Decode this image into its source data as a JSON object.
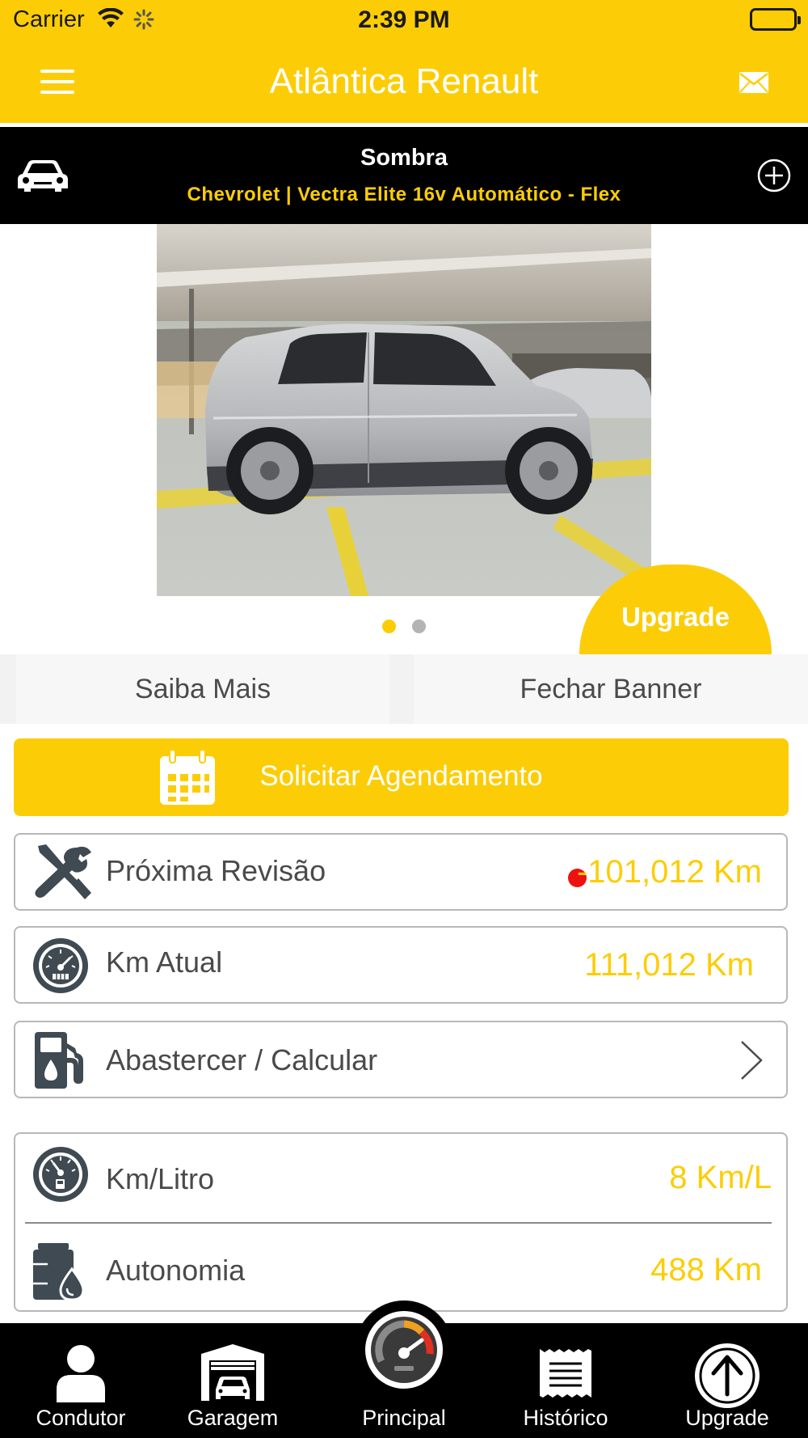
{
  "status_bar": {
    "carrier": "Carrier",
    "time": "2:39 PM"
  },
  "navbar": {
    "title": "Atlântica Renault",
    "menu_icon": "hamburger-menu-icon",
    "mail_icon": "envelope-icon"
  },
  "vehicle": {
    "name": "Sombra",
    "model": "Chevrolet | Vectra Elite 16v Automático - Flex",
    "car_icon": "car-icon",
    "add_icon": "plus-circle-icon"
  },
  "carousel": {
    "total_pages": 2,
    "current_page": 1,
    "upgrade_label": "Upgrade"
  },
  "banner": {
    "learn_more": "Saiba Mais",
    "close_banner": "Fechar Banner"
  },
  "schedule": {
    "label": "Solicitar Agendamento",
    "icon": "calendar-icon"
  },
  "rows": {
    "next_service": {
      "label": "Próxima Revisão",
      "value": "-101,012 Km",
      "icon": "wrench-screwdriver-icon",
      "alert": true
    },
    "current_km": {
      "label": "Km Atual",
      "value": "111,012 Km",
      "icon": "odometer-icon"
    },
    "refuel": {
      "label": "Abastercer / Calcular",
      "icon": "fuel-pump-icon"
    },
    "km_per_liter": {
      "label": "Km/Litro",
      "value": "8 Km/L",
      "icon": "fuel-gauge-icon"
    },
    "range": {
      "label": "Autonomia",
      "value": "488 Km",
      "icon": "fuel-tank-icon"
    }
  },
  "colors": {
    "brand_yellow": "#fccd06",
    "alert_red": "#ee1111",
    "tabbar_black": "#000000"
  },
  "tabs": [
    {
      "label": "Condutor",
      "icon": "person-icon"
    },
    {
      "label": "Garagem",
      "icon": "garage-icon"
    },
    {
      "label": "Principal",
      "icon": "speedometer-icon"
    },
    {
      "label": "Histórico",
      "icon": "receipt-icon"
    },
    {
      "label": "Upgrade",
      "icon": "arrow-up-circle-icon"
    }
  ]
}
